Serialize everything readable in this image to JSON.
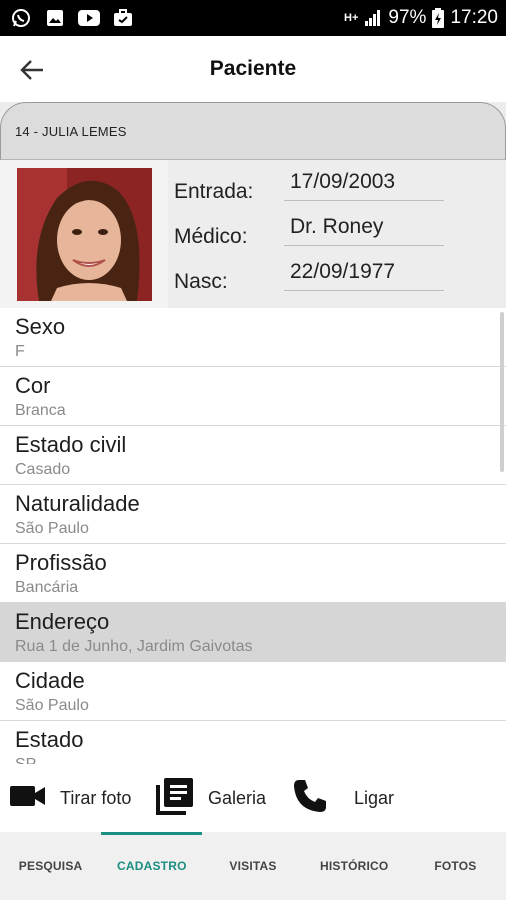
{
  "status_bar": {
    "left_icons": [
      "whatsapp-icon",
      "gallery-icon",
      "youtube-icon",
      "briefcase-icon"
    ],
    "network": "H+",
    "battery": "97%",
    "time": "17:20"
  },
  "header": {
    "title": "Paciente",
    "back_icon": "arrow-back-icon"
  },
  "patient": {
    "tab_label": "14 - JULIA LEMES",
    "fields": [
      {
        "label": "Entrada:",
        "value": "17/09/2003"
      },
      {
        "label": "Médico:",
        "value": "Dr. Roney"
      },
      {
        "label": "Nasc:",
        "value": "22/09/1977"
      }
    ]
  },
  "details": [
    {
      "title": "Sexo",
      "value": "F"
    },
    {
      "title": "Cor",
      "value": "Branca"
    },
    {
      "title": "Estado civil",
      "value": "Casado"
    },
    {
      "title": "Naturalidade",
      "value": "São Paulo"
    },
    {
      "title": "Profissão",
      "value": "Bancária"
    },
    {
      "title": "Endereço",
      "value": "Rua 1 de Junho, Jardim Gaivotas"
    },
    {
      "title": "Cidade",
      "value": "São Paulo"
    },
    {
      "title": "Estado",
      "value": "SP"
    }
  ],
  "actions": {
    "photo_label": "Tirar foto",
    "gallery_label": "Galeria",
    "call_label": "Ligar"
  },
  "nav": {
    "tabs": [
      "PESQUISA",
      "CADASTRO",
      "VISITAS",
      "HISTÓRICO",
      "FOTOS"
    ],
    "active": "CADASTRO"
  },
  "colors": {
    "accent": "#1a8e80",
    "selected_row": "#d6d6d6"
  }
}
